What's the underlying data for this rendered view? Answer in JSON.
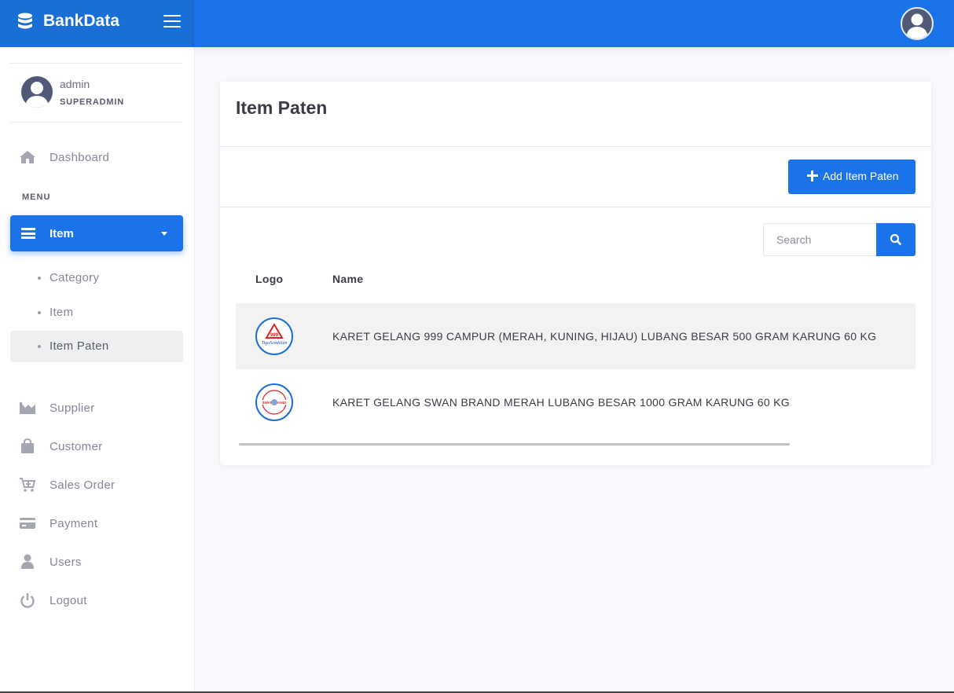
{
  "brand": {
    "name": "BankData"
  },
  "user": {
    "name": "admin",
    "role": "SUPERADMIN"
  },
  "sidebar": {
    "dashboard": "Dashboard",
    "menu_heading": "MENU",
    "item_group": "Item",
    "sub_items": [
      {
        "label": "Category"
      },
      {
        "label": "Item"
      },
      {
        "label": "Item Paten"
      }
    ],
    "links": [
      {
        "label": "Supplier",
        "icon": "chart-area-icon"
      },
      {
        "label": "Customer",
        "icon": "shopping-bag-icon"
      },
      {
        "label": "Sales Order",
        "icon": "cart-plus-icon"
      },
      {
        "label": "Payment",
        "icon": "credit-card-icon"
      },
      {
        "label": "Users",
        "icon": "user-icon"
      },
      {
        "label": "Logout",
        "icon": "power-icon"
      }
    ]
  },
  "card": {
    "title": "Item Paten",
    "add_button": "Add Item Paten",
    "search_placeholder": "Search",
    "columns": [
      "Logo",
      "Name"
    ],
    "rows": [
      {
        "name": "KARET GELANG 999 CAMPUR (MERAH, KUNING, HIJAU) LUBANG BESAR 500 GRAM KARUNG 60 KG",
        "logo": "TigaSembilan"
      },
      {
        "name": "KARET GELANG SWAN BRAND MERAH LUBANG BESAR 1000 GRAM KARUNG 60 KG",
        "logo": "SWAN BRAND"
      }
    ]
  },
  "colors": {
    "primary": "#1a73e8",
    "brand_bg": "#1a6fd6",
    "page_bg": "#f8f9fc"
  }
}
